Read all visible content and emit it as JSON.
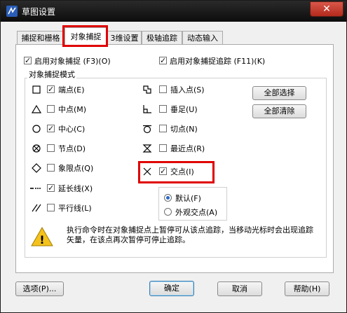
{
  "window": {
    "title": "草图设置",
    "close_label": "✕"
  },
  "tabs": [
    {
      "label": "捕捉和栅格",
      "active": false
    },
    {
      "label": "对象捕捉",
      "active": true
    },
    {
      "label": "3维设置",
      "active": false
    },
    {
      "label": "极轴追踪",
      "active": false
    },
    {
      "label": "动态输入",
      "active": false
    }
  ],
  "top_options": {
    "enable_osnap": {
      "label": "启用对象捕捉 (F3)(O)",
      "checked": true
    },
    "enable_tracking": {
      "label": "启用对象捕捉追踪 (F11)(K)",
      "checked": true
    }
  },
  "group_title": "对象捕捉模式",
  "snap_left": [
    {
      "label": "端点(E)",
      "checked": true,
      "icon": "square-endpoint-icon"
    },
    {
      "label": "中点(M)",
      "checked": false,
      "icon": "triangle-midpoint-icon"
    },
    {
      "label": "中心(C)",
      "checked": true,
      "icon": "circle-center-icon"
    },
    {
      "label": "节点(D)",
      "checked": false,
      "icon": "node-icon"
    },
    {
      "label": "象限点(Q)",
      "checked": false,
      "icon": "diamond-quadrant-icon"
    },
    {
      "label": "延长线(X)",
      "checked": true,
      "icon": "extension-icon"
    },
    {
      "label": "平行线(L)",
      "checked": false,
      "icon": "parallel-icon"
    }
  ],
  "snap_right": [
    {
      "label": "插入点(S)",
      "checked": false,
      "icon": "insertion-icon"
    },
    {
      "label": "垂足(U)",
      "checked": false,
      "icon": "perpendicular-icon"
    },
    {
      "label": "切点(N)",
      "checked": false,
      "icon": "tangent-icon"
    },
    {
      "label": "最近点(R)",
      "checked": false,
      "icon": "nearest-icon"
    },
    {
      "label": "交点(I)",
      "checked": true,
      "icon": "intersection-icon"
    }
  ],
  "intersection_modes": [
    {
      "label": "默认(F)",
      "selected": true
    },
    {
      "label": "外观交点(A)",
      "selected": false
    }
  ],
  "buttons": {
    "select_all": "全部选择",
    "clear_all": "全部清除",
    "options": "选项(P)...",
    "ok": "确定",
    "cancel": "取消",
    "help": "帮助(H)"
  },
  "hint": "执行命令时在对象捕捉点上暂停可从该点追踪，当移动光标时会出现追踪矢量，在该点再次暂停可停止追踪。",
  "check_glyph": "✓",
  "warning_glyph": "!"
}
